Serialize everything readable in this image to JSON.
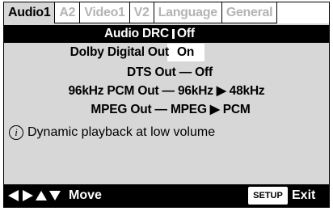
{
  "tabs": [
    {
      "label": "Audio1",
      "active": true
    },
    {
      "label": "A2",
      "active": false
    },
    {
      "label": "Video1",
      "active": false
    },
    {
      "label": "V2",
      "active": false
    },
    {
      "label": "Language",
      "active": false
    },
    {
      "label": "General",
      "active": false
    }
  ],
  "settings": {
    "audio_drc": {
      "label": "Audio DRC",
      "value": "Off"
    },
    "dolby_digital_out": {
      "label": "Dolby Digital Out",
      "value": "On"
    },
    "dts_out": "DTS Out — Off",
    "pcm_out": "96kHz PCM Out — 96kHz ▶ 48kHz",
    "mpeg_out": "MPEG Out — MPEG ▶ PCM"
  },
  "info": {
    "icon": "info-icon",
    "text": "Dynamic playback at low volume"
  },
  "footer": {
    "move_label": "Move",
    "setup_label": "SETUP",
    "exit_label": "Exit"
  },
  "colors": {
    "panel": "#d7d7d7",
    "highlight": "#000000",
    "inactive_tab": "#b4b4b4"
  }
}
